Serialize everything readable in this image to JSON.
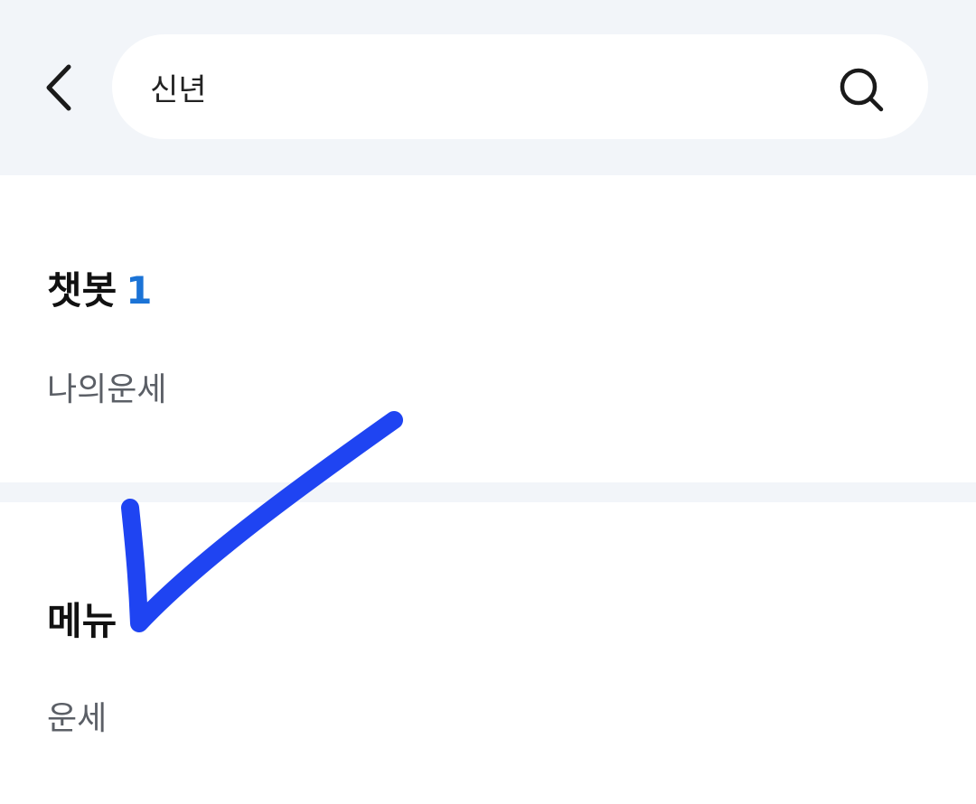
{
  "search": {
    "query": "신년"
  },
  "icons": {
    "back": "chevron-left-icon",
    "search": "search-icon"
  },
  "sections": {
    "chatbot": {
      "title": "챗봇",
      "count": "1",
      "items": [
        {
          "label": "나의운세"
        }
      ]
    },
    "menu": {
      "title": "메뉴",
      "items": [
        {
          "label": "운세"
        }
      ]
    }
  },
  "colors": {
    "header_bg": "#f2f5f9",
    "accent_count": "#1b73d6",
    "checkmark_stroke": "#1f44f2"
  }
}
